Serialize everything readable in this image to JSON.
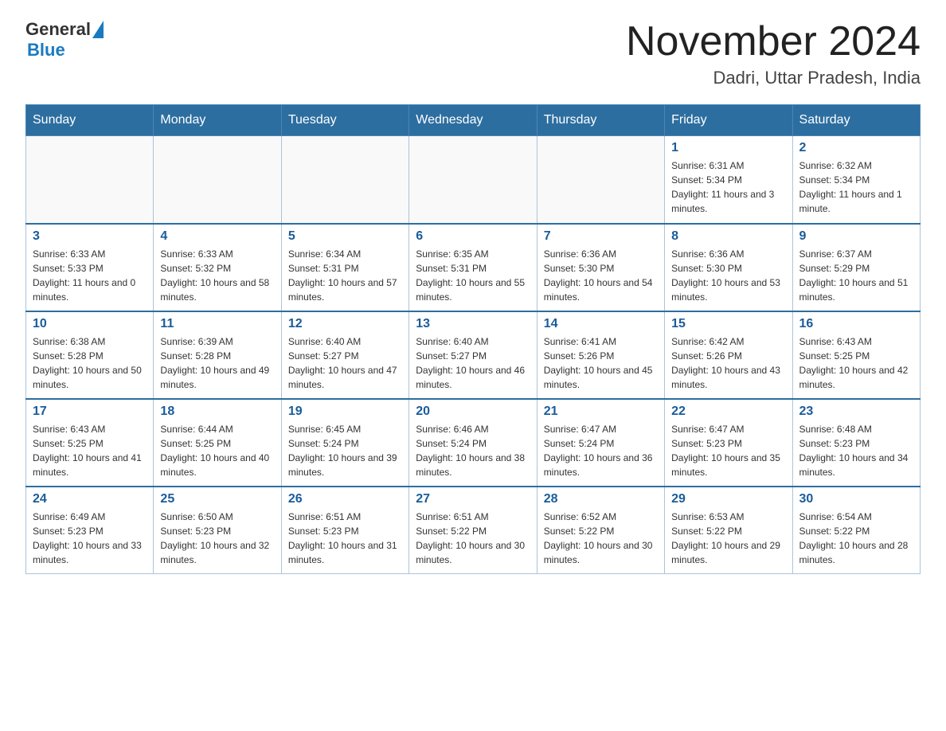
{
  "header": {
    "logo_text_general": "General",
    "logo_text_blue": "Blue",
    "month_title": "November 2024",
    "location": "Dadri, Uttar Pradesh, India"
  },
  "days_of_week": [
    "Sunday",
    "Monday",
    "Tuesday",
    "Wednesday",
    "Thursday",
    "Friday",
    "Saturday"
  ],
  "weeks": [
    {
      "days": [
        {
          "date": "",
          "info": ""
        },
        {
          "date": "",
          "info": ""
        },
        {
          "date": "",
          "info": ""
        },
        {
          "date": "",
          "info": ""
        },
        {
          "date": "",
          "info": ""
        },
        {
          "date": "1",
          "info": "Sunrise: 6:31 AM\nSunset: 5:34 PM\nDaylight: 11 hours and 3 minutes."
        },
        {
          "date": "2",
          "info": "Sunrise: 6:32 AM\nSunset: 5:34 PM\nDaylight: 11 hours and 1 minute."
        }
      ]
    },
    {
      "days": [
        {
          "date": "3",
          "info": "Sunrise: 6:33 AM\nSunset: 5:33 PM\nDaylight: 11 hours and 0 minutes."
        },
        {
          "date": "4",
          "info": "Sunrise: 6:33 AM\nSunset: 5:32 PM\nDaylight: 10 hours and 58 minutes."
        },
        {
          "date": "5",
          "info": "Sunrise: 6:34 AM\nSunset: 5:31 PM\nDaylight: 10 hours and 57 minutes."
        },
        {
          "date": "6",
          "info": "Sunrise: 6:35 AM\nSunset: 5:31 PM\nDaylight: 10 hours and 55 minutes."
        },
        {
          "date": "7",
          "info": "Sunrise: 6:36 AM\nSunset: 5:30 PM\nDaylight: 10 hours and 54 minutes."
        },
        {
          "date": "8",
          "info": "Sunrise: 6:36 AM\nSunset: 5:30 PM\nDaylight: 10 hours and 53 minutes."
        },
        {
          "date": "9",
          "info": "Sunrise: 6:37 AM\nSunset: 5:29 PM\nDaylight: 10 hours and 51 minutes."
        }
      ]
    },
    {
      "days": [
        {
          "date": "10",
          "info": "Sunrise: 6:38 AM\nSunset: 5:28 PM\nDaylight: 10 hours and 50 minutes."
        },
        {
          "date": "11",
          "info": "Sunrise: 6:39 AM\nSunset: 5:28 PM\nDaylight: 10 hours and 49 minutes."
        },
        {
          "date": "12",
          "info": "Sunrise: 6:40 AM\nSunset: 5:27 PM\nDaylight: 10 hours and 47 minutes."
        },
        {
          "date": "13",
          "info": "Sunrise: 6:40 AM\nSunset: 5:27 PM\nDaylight: 10 hours and 46 minutes."
        },
        {
          "date": "14",
          "info": "Sunrise: 6:41 AM\nSunset: 5:26 PM\nDaylight: 10 hours and 45 minutes."
        },
        {
          "date": "15",
          "info": "Sunrise: 6:42 AM\nSunset: 5:26 PM\nDaylight: 10 hours and 43 minutes."
        },
        {
          "date": "16",
          "info": "Sunrise: 6:43 AM\nSunset: 5:25 PM\nDaylight: 10 hours and 42 minutes."
        }
      ]
    },
    {
      "days": [
        {
          "date": "17",
          "info": "Sunrise: 6:43 AM\nSunset: 5:25 PM\nDaylight: 10 hours and 41 minutes."
        },
        {
          "date": "18",
          "info": "Sunrise: 6:44 AM\nSunset: 5:25 PM\nDaylight: 10 hours and 40 minutes."
        },
        {
          "date": "19",
          "info": "Sunrise: 6:45 AM\nSunset: 5:24 PM\nDaylight: 10 hours and 39 minutes."
        },
        {
          "date": "20",
          "info": "Sunrise: 6:46 AM\nSunset: 5:24 PM\nDaylight: 10 hours and 38 minutes."
        },
        {
          "date": "21",
          "info": "Sunrise: 6:47 AM\nSunset: 5:24 PM\nDaylight: 10 hours and 36 minutes."
        },
        {
          "date": "22",
          "info": "Sunrise: 6:47 AM\nSunset: 5:23 PM\nDaylight: 10 hours and 35 minutes."
        },
        {
          "date": "23",
          "info": "Sunrise: 6:48 AM\nSunset: 5:23 PM\nDaylight: 10 hours and 34 minutes."
        }
      ]
    },
    {
      "days": [
        {
          "date": "24",
          "info": "Sunrise: 6:49 AM\nSunset: 5:23 PM\nDaylight: 10 hours and 33 minutes."
        },
        {
          "date": "25",
          "info": "Sunrise: 6:50 AM\nSunset: 5:23 PM\nDaylight: 10 hours and 32 minutes."
        },
        {
          "date": "26",
          "info": "Sunrise: 6:51 AM\nSunset: 5:23 PM\nDaylight: 10 hours and 31 minutes."
        },
        {
          "date": "27",
          "info": "Sunrise: 6:51 AM\nSunset: 5:22 PM\nDaylight: 10 hours and 30 minutes."
        },
        {
          "date": "28",
          "info": "Sunrise: 6:52 AM\nSunset: 5:22 PM\nDaylight: 10 hours and 30 minutes."
        },
        {
          "date": "29",
          "info": "Sunrise: 6:53 AM\nSunset: 5:22 PM\nDaylight: 10 hours and 29 minutes."
        },
        {
          "date": "30",
          "info": "Sunrise: 6:54 AM\nSunset: 5:22 PM\nDaylight: 10 hours and 28 minutes."
        }
      ]
    }
  ]
}
